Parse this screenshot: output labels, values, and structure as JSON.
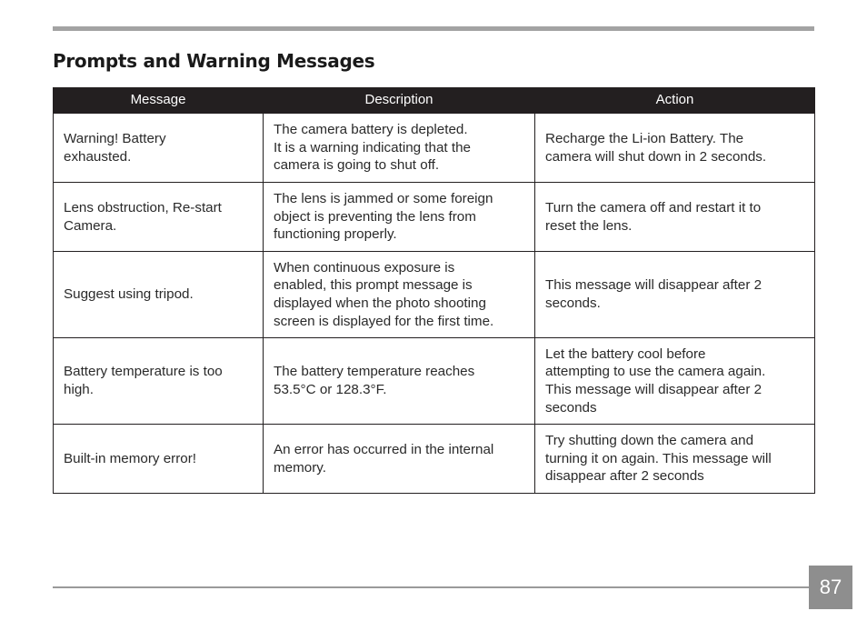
{
  "page": {
    "title": "Prompts and Warning Messages",
    "page_number": "87"
  },
  "table": {
    "headers": [
      "Message",
      "Description",
      "Action"
    ],
    "rows": [
      {
        "message": "Warning! Battery\nexhausted.",
        "description": "The camera battery is depleted.\nIt is a warning indicating that the\ncamera is going to shut off.",
        "action": "Recharge the Li-ion Battery. The\ncamera will shut down in 2 seconds."
      },
      {
        "message": "Lens obstruction, Re-start\nCamera.",
        "description": "The lens is jammed or some foreign\nobject is preventing the lens from\nfunctioning properly.",
        "action": "Turn the camera off and restart it to\nreset the lens."
      },
      {
        "message": "Suggest using tripod.",
        "description": "When continuous exposure is\nenabled, this prompt message is\ndisplayed when the photo shooting\nscreen is displayed for the first time.",
        "action": "This message will disappear after 2\nseconds."
      },
      {
        "message": "Battery temperature is too\nhigh.",
        "description": "The battery temperature reaches\n53.5°C or 128.3°F.",
        "action": "Let the battery cool before\nattempting to use the camera again.\nThis message will disappear after 2\nseconds"
      },
      {
        "message": "Built-in memory error!",
        "description": "An error has occurred in the internal\nmemory.",
        "action": "Try shutting down the camera and\nturning it on again. This message will\ndisappear after 2 seconds"
      }
    ]
  }
}
